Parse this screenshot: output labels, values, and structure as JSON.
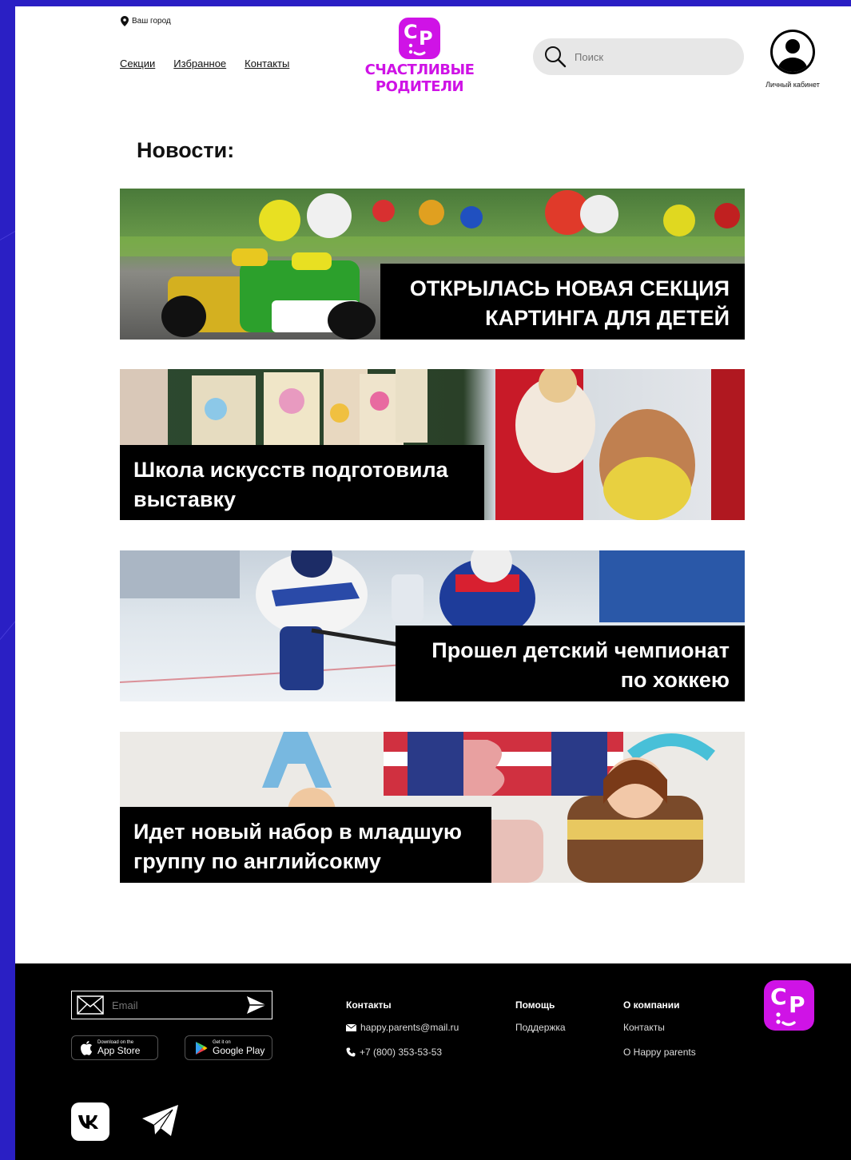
{
  "header": {
    "city": "Ваш город",
    "nav": [
      "Секции",
      "Избранное",
      "Контакты"
    ],
    "logo": {
      "badge_left": "С",
      "badge_right": "Р",
      "line1": "СЧАСТЛИВЫЕ",
      "line2": "РОДИТЕЛИ"
    },
    "search_placeholder": "Поиск",
    "account_label": "Личный кабинет"
  },
  "news": {
    "title": "Новости:",
    "items": [
      {
        "line1": "ОТКРЫЛАСЬ НОВАЯ СЕКЦИЯ",
        "line2": "КАРТИНГА ДЛЯ ДЕТЕЙ"
      },
      {
        "line1": "Школа искусств подготовила",
        "line2": "выставку"
      },
      {
        "line1": "Прошел детский чемпионат",
        "line2": "по хоккею"
      },
      {
        "line1": "Идет новый набор в младшую",
        "line2": "группу по английсокму"
      }
    ]
  },
  "footer": {
    "email_placeholder": "Email",
    "app_store": {
      "small": "Download on the",
      "big": "App Store"
    },
    "google_play": {
      "small": "Get it on",
      "big": "Google Play"
    },
    "contacts": {
      "title": "Контакты",
      "email": "happy.parents@mail.ru",
      "phone": "+7 (800) 353-53-53"
    },
    "help": {
      "title": "Помощь",
      "support": "Поддержка"
    },
    "company": {
      "title": "О компании",
      "contacts": "Контакты",
      "about": "О Happy parents"
    }
  },
  "colors": {
    "brand": "#cf13e6",
    "background": "#2a1fc4",
    "footer": "#000000"
  }
}
